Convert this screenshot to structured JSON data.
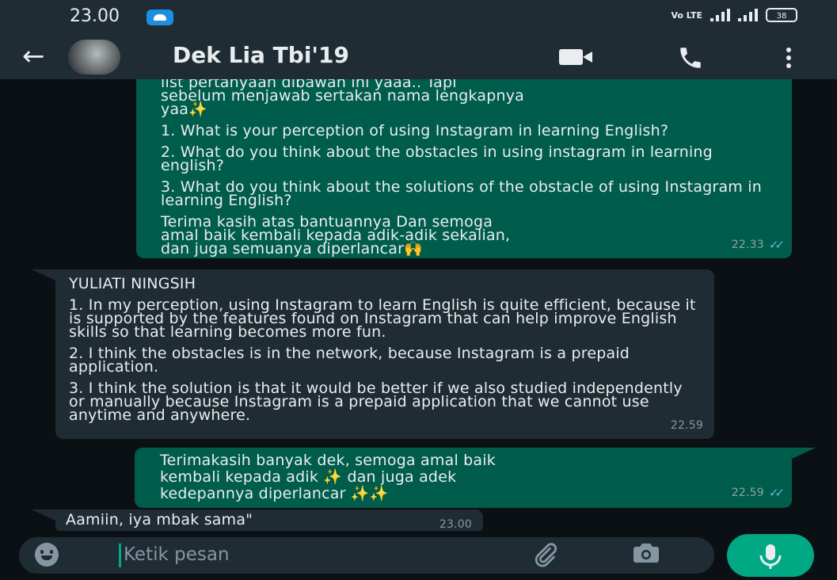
{
  "status_bar": {
    "time": "23.00",
    "volte": "Vo LTE",
    "battery": "38"
  },
  "header": {
    "contact_name": "Dek Lia Tbi'19"
  },
  "messages": {
    "m1": {
      "intro_line1": "list pertanyaan dibawah ini yaaa..  Tapi",
      "intro_line2": "sebelum menjawab sertakan nama lengkapnya",
      "intro_line3": "yaa",
      "q1": "1. What is your perception of using Instagram in learning English?",
      "q2": "2. What do you think about the obstacles in using instagram in learning english?",
      "q3": "3. What do you think about the solutions of the obstacle of using Instagram in learning English?",
      "closing_line1": "Terima kasih atas bantuannya Dan semoga",
      "closing_line2": "amal baik kembali kepada adik-adik sekalian,",
      "closing_line3": "dan juga semuanya diperlancar",
      "time": "22.33"
    },
    "m2": {
      "name": "YULIATI NINGSIH",
      "a1": "1. In my perception, using Instagram to learn English is quite efficient, because it is supported by the features found on Instagram that can help improve English skills so that learning becomes more fun.",
      "a2": "2. I think the obstacles is in the network, because Instagram is a prepaid application.",
      "a3": "3. I think the solution is that it would be better if we also studied independently or manually because Instagram is a prepaid application that we cannot use anytime and anywhere.",
      "time": "22.59"
    },
    "m3": {
      "line1": "Terimakasih banyak dek, semoga amal baik",
      "line2a": "kembali kepada adik",
      "line2b": "dan juga adek",
      "line3": "kedepannya diperlancar",
      "time": "22.59"
    },
    "m4": {
      "text": "Aamiin, iya mbak sama\"",
      "time": "23.00"
    }
  },
  "composer": {
    "placeholder": "Ketik pesan"
  },
  "icons": {
    "back": "back-arrow-icon",
    "video": "video-call-icon",
    "call": "phone-call-icon",
    "menu": "more-vert-icon",
    "emoji": "emoji-icon",
    "attach": "attachment-icon",
    "camera": "camera-icon",
    "mic": "microphone-icon"
  },
  "colors": {
    "outgoing_bubble": "#005c4b",
    "incoming_bubble": "#202c33",
    "accent": "#00a884",
    "read_ticks": "#53bdeb"
  }
}
